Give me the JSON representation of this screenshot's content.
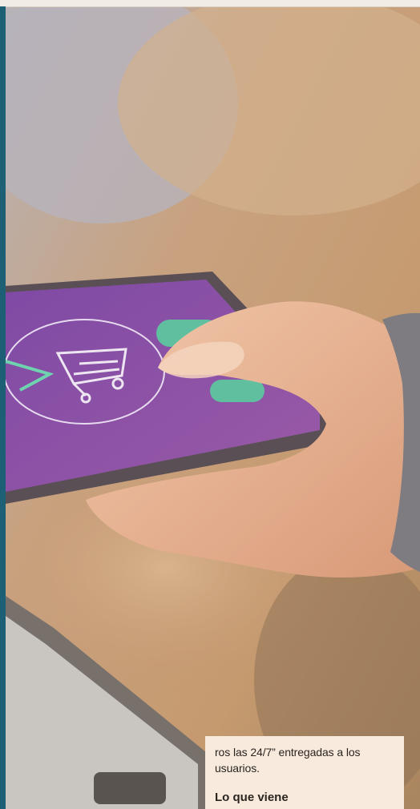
{
  "article": {
    "snippet": "ros las 24/7” entregadas a los usuarios.",
    "next_heading": "Lo que viene"
  },
  "colors": {
    "accent_bar": "#1d5f74",
    "card_bg": "#f8eadd",
    "phone_screen": "#8a4ea3",
    "app_button": "#5fbf9f"
  },
  "icons": [
    "shopping-cart-icon",
    "arrow-left-icon"
  ]
}
